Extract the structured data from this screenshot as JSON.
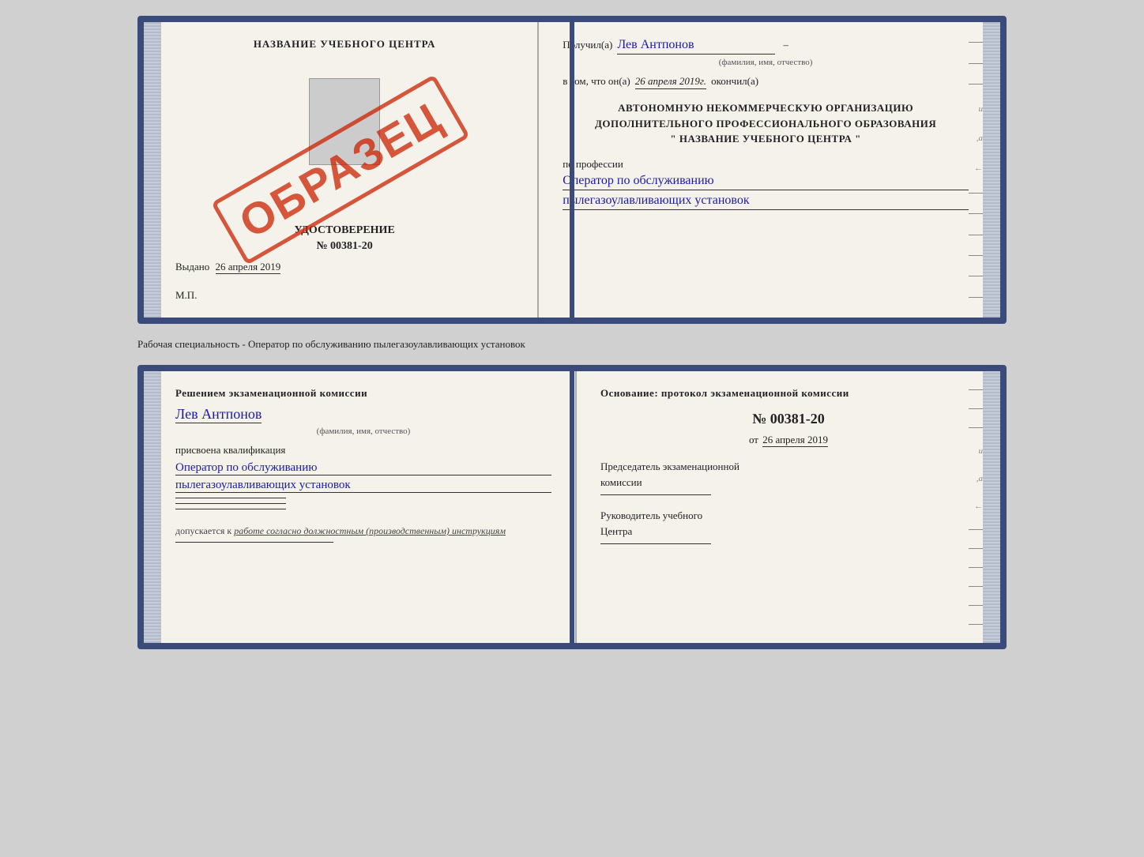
{
  "cert_top": {
    "left": {
      "title": "НАЗВАНИЕ УЧЕБНОГО ЦЕНТРА",
      "udostoverenie": "УДОСТОВЕРЕНИЕ",
      "number": "№ 00381-20",
      "vydano_label": "Выдано",
      "vydano_date": "26 апреля 2019",
      "mp": "М.П.",
      "stamp": "ОБРАЗЕЦ"
    },
    "right": {
      "poluchil": "Получил(а)",
      "name": "Лев Антпонов",
      "fio_subtitle": "(фамилия, имя, отчество)",
      "dash": "–",
      "v_tom": "в том, что он(а)",
      "date": "26 апреля 2019г.",
      "okonchil": "окончил(а)",
      "org1": "АВТОНОМНУЮ НЕКОММЕРЧЕСКУЮ ОРГАНИЗАЦИЮ",
      "org2": "ДОПОЛНИТЕЛЬНОГО ПРОФЕССИОНАЛЬНОГО ОБРАЗОВАНИЯ",
      "org3": "\" НАЗВАНИЕ УЧЕБНОГО ЦЕНТРА \"",
      "po_professii": "по профессии",
      "prof1": "Оператор по обслуживанию",
      "prof2": "пылегазоулавливающих установок",
      "deco_i": "и",
      "deco_a": ",а",
      "deco_arrow": "←",
      "dashes": [
        "–",
        "–",
        "–",
        "–",
        "–",
        "–"
      ]
    }
  },
  "middle_text": "Рабочая специальность - Оператор по обслуживанию пылегазоулавливающих установок",
  "cert_bottom": {
    "left": {
      "resheniem": "Решением экзаменационной комиссии",
      "name": "Лев Антпонов",
      "fio_subtitle": "(фамилия, имя, отчество)",
      "prisvoena": "присвоена квалификация",
      "kval1": "Оператор по обслуживанию",
      "kval2": "пылегазоулавливающих установок",
      "dopusk_label": "допускается к",
      "dopusk_val": "работе согласно должностным (производственным) инструкциям"
    },
    "right": {
      "osnov": "Основание: протокол экзаменационной комиссии",
      "number": "№  00381-20",
      "ot_label": "от",
      "ot_date": "26 апреля 2019",
      "predsed1": "Председатель экзаменационной",
      "predsed2": "комиссии",
      "ruk1": "Руководитель учебного",
      "ruk2": "Центра",
      "deco_i": "и",
      "deco_a": ",а",
      "deco_arrow": "←",
      "dashes": [
        "–",
        "–",
        "–",
        "–",
        "–",
        "–"
      ]
    }
  }
}
